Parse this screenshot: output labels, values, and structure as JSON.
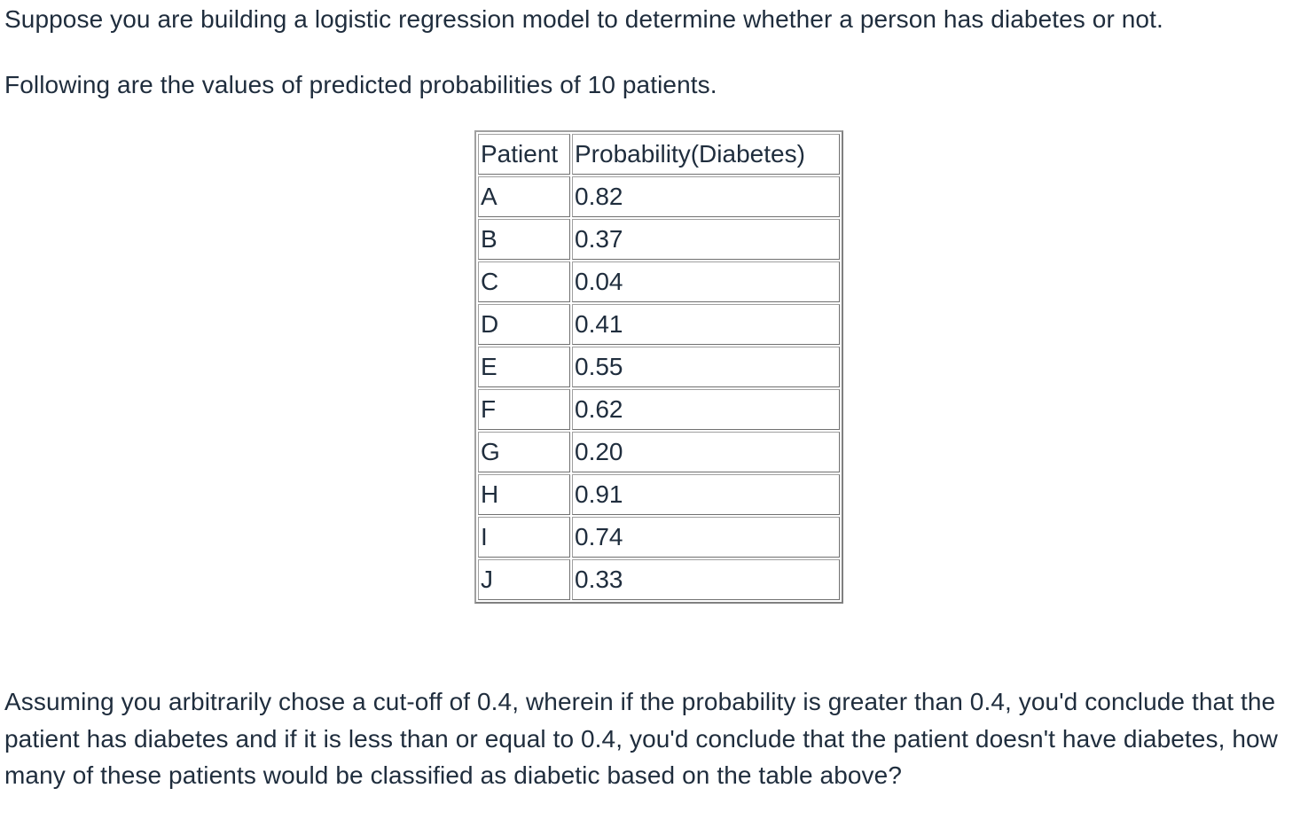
{
  "question": {
    "intro": "Suppose you are building a logistic regression model to determine whether a person has diabetes or not.",
    "lead_in": "Following are the values of predicted probabilities of 10 patients.",
    "prompt": "Assuming you arbitrarily chose a cut-off of 0.4, wherein if the probability is greater than 0.4, you'd conclude that the patient has diabetes and if it is less than or equal to 0.4, you'd conclude that the patient doesn't have diabetes, how many of these patients would be classified as diabetic based on the table above?"
  },
  "table": {
    "headers": [
      "Patient",
      "Probability(Diabetes)"
    ],
    "rows": [
      {
        "patient": "A",
        "probability": "0.82"
      },
      {
        "patient": "B",
        "probability": "0.37"
      },
      {
        "patient": "C",
        "probability": "0.04"
      },
      {
        "patient": "D",
        "probability": "0.41"
      },
      {
        "patient": "E",
        "probability": "0.55"
      },
      {
        "patient": "F",
        "probability": "0.62"
      },
      {
        "patient": "G",
        "probability": "0.20"
      },
      {
        "patient": "H",
        "probability": "0.91"
      },
      {
        "patient": "I",
        "probability": "0.74"
      },
      {
        "patient": "J",
        "probability": "0.33"
      }
    ]
  }
}
